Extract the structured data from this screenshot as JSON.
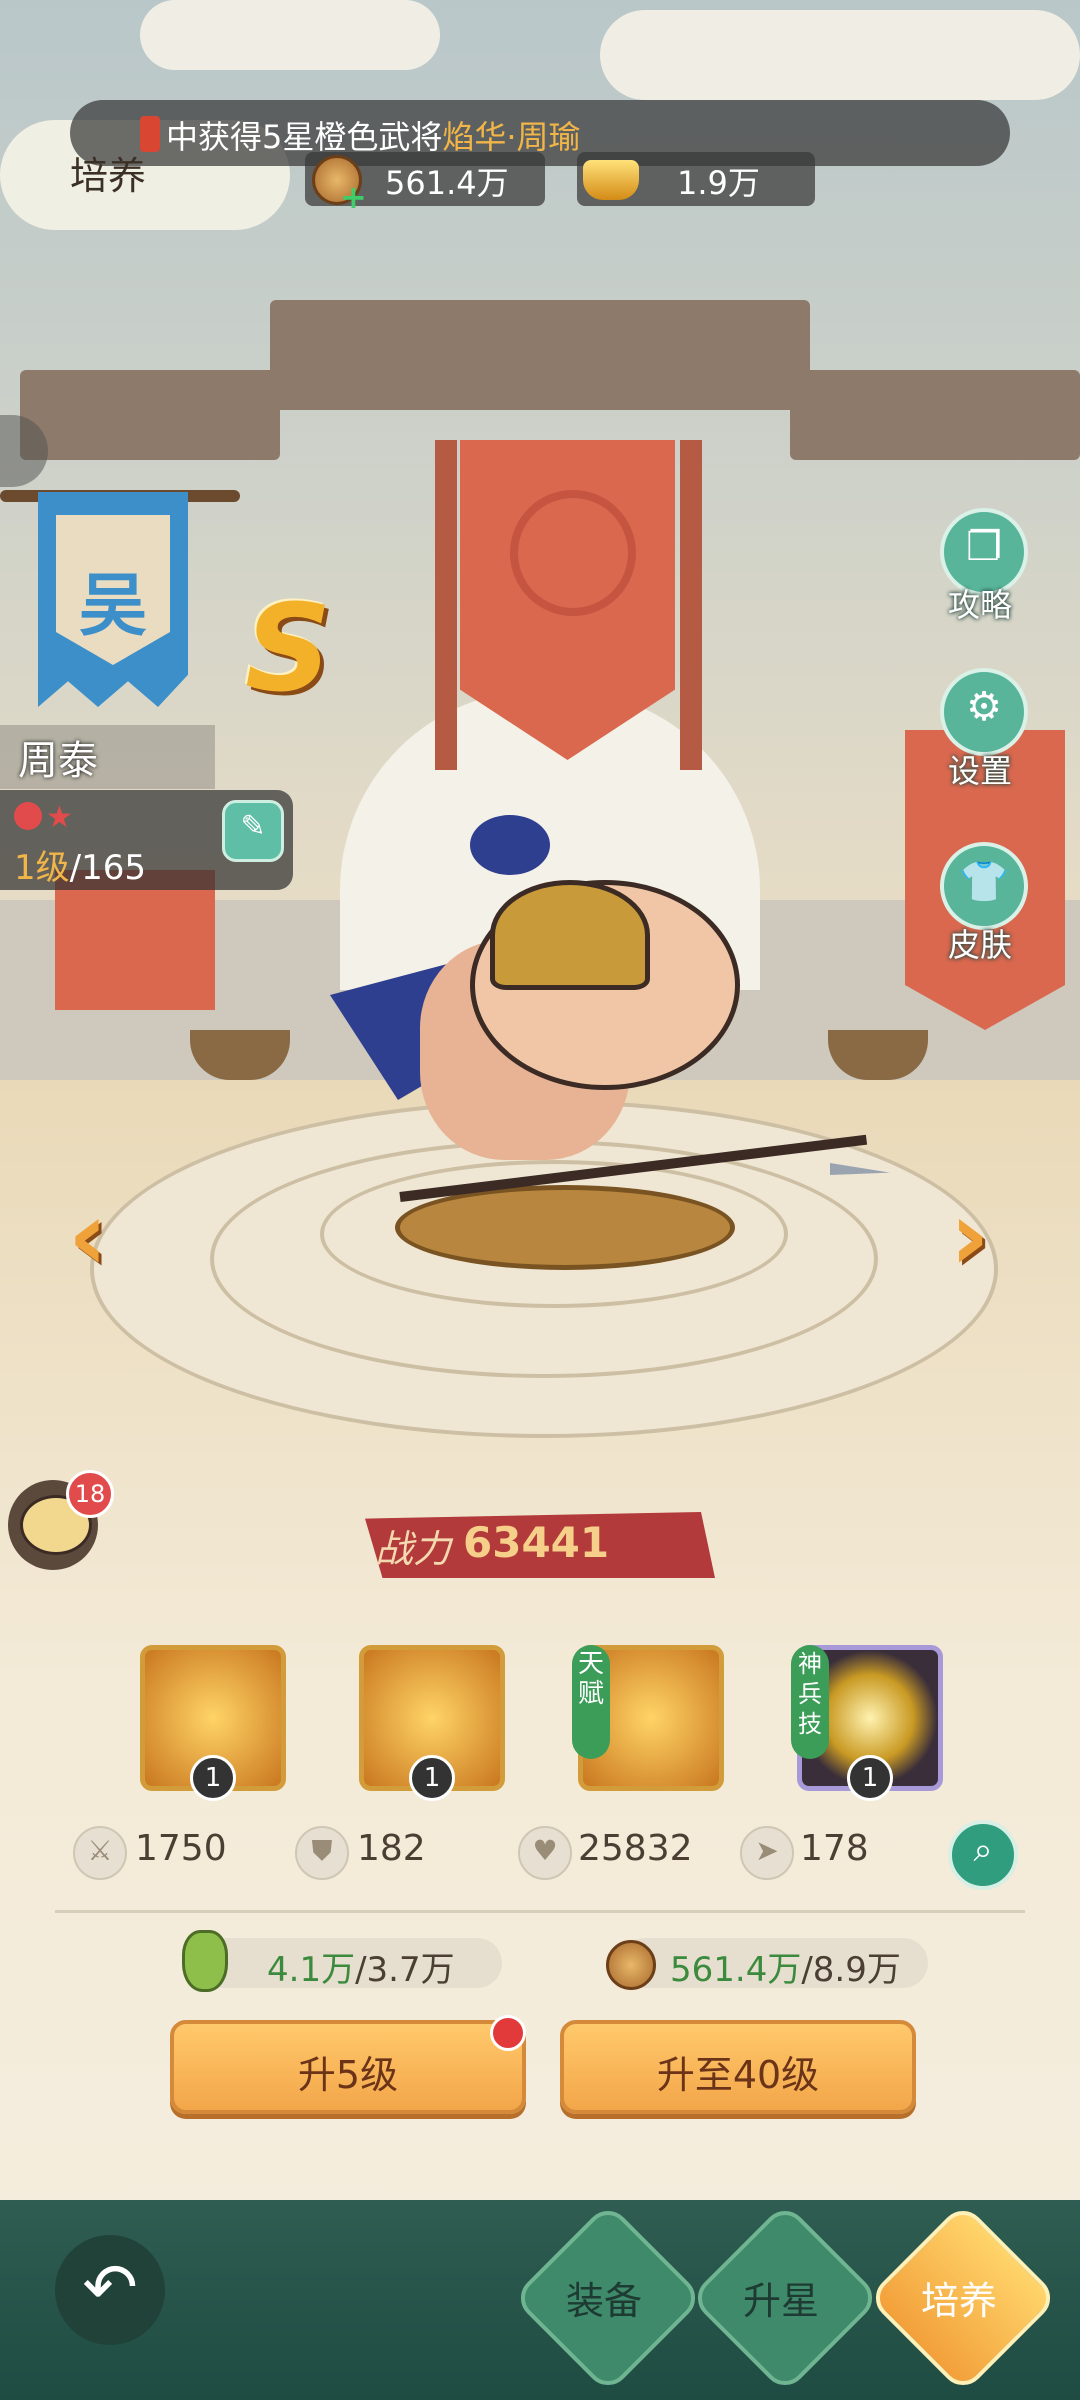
{
  "ticker": {
    "text_prefix": "中获得5星橙色武将",
    "highlight": "焰华·周瑜"
  },
  "page_title": "培养",
  "resources": {
    "copper": "561.4万",
    "gold": "1.9万"
  },
  "faction": "吴",
  "rank": "S",
  "hero": {
    "name": "周泰",
    "level_current": "1级",
    "level_max": "/165"
  },
  "right_menu": {
    "guide": "攻略",
    "settings": "设置",
    "skin": "皮肤"
  },
  "chat": {
    "badge": "18"
  },
  "power": {
    "label": "战力",
    "value": "63441"
  },
  "skills": [
    {
      "level": "1"
    },
    {
      "level": "1"
    },
    {
      "tag": "天赋"
    },
    {
      "tag": "神兵技",
      "level": "1"
    }
  ],
  "stats": {
    "attack": "1750",
    "defense": "182",
    "hp": "25832",
    "speed": "178"
  },
  "cost": {
    "exp_have": "4.1万",
    "exp_need": "/3.7万",
    "copper_have": "561.4万",
    "copper_need": "/8.9万"
  },
  "buttons": {
    "up5": "升5级",
    "up40": "升至40级"
  },
  "bottom_tabs": {
    "equip": "装备",
    "star": "升星",
    "train": "培养"
  },
  "icons": {
    "back": "back-arrow-icon",
    "search": "search-icon",
    "chat": "chat-icon"
  },
  "colors": {
    "accent_orange": "#f3a64a",
    "accent_green": "#3f8a6b",
    "power_red": "#b33a3a"
  }
}
